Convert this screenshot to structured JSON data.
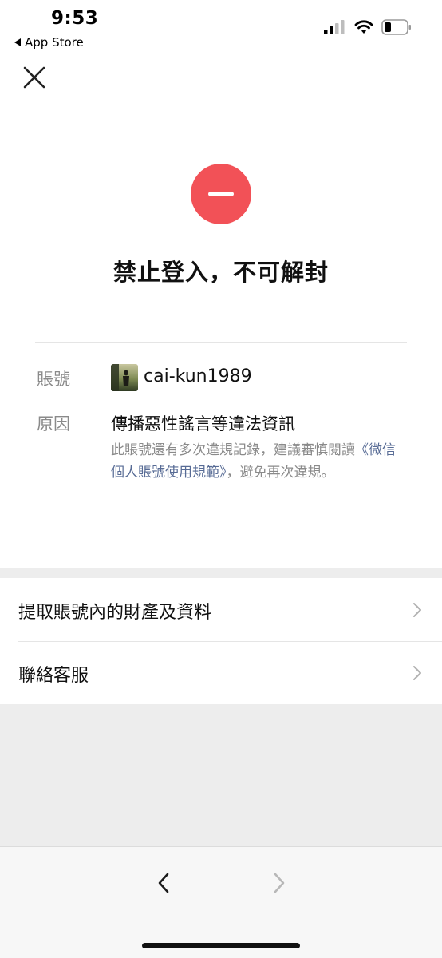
{
  "status_bar": {
    "time": "9:53",
    "back_app_label": "App Store",
    "icons": [
      "cellular-signal-icon",
      "wifi-icon",
      "battery-icon"
    ]
  },
  "close_icon": "close-icon",
  "status_icon": "ban-icon",
  "title": "禁止登入，不可解封",
  "info": {
    "account_label": "賬號",
    "account_name": "cai-kun1989",
    "reason_label": "原因",
    "reason_text": "傳播惡性謠言等違法資訊",
    "note_prefix": "此賬號還有多次違規記錄，建議審慎閱讀",
    "note_link": "《微信個人賬號使用規範》",
    "note_suffix": "，避免再次違規。"
  },
  "menu": [
    {
      "label": "提取賬號內的財產及資料",
      "icon": "chevron-right-icon"
    },
    {
      "label": "聯絡客服",
      "icon": "chevron-right-icon"
    }
  ],
  "toolbar": {
    "back_icon": "chevron-left-icon",
    "forward_icon": "chevron-right-icon"
  },
  "colors": {
    "danger": "#f25157",
    "link": "#576b95",
    "muted_text": "#8a8a8a",
    "background_gray": "#ededed"
  }
}
